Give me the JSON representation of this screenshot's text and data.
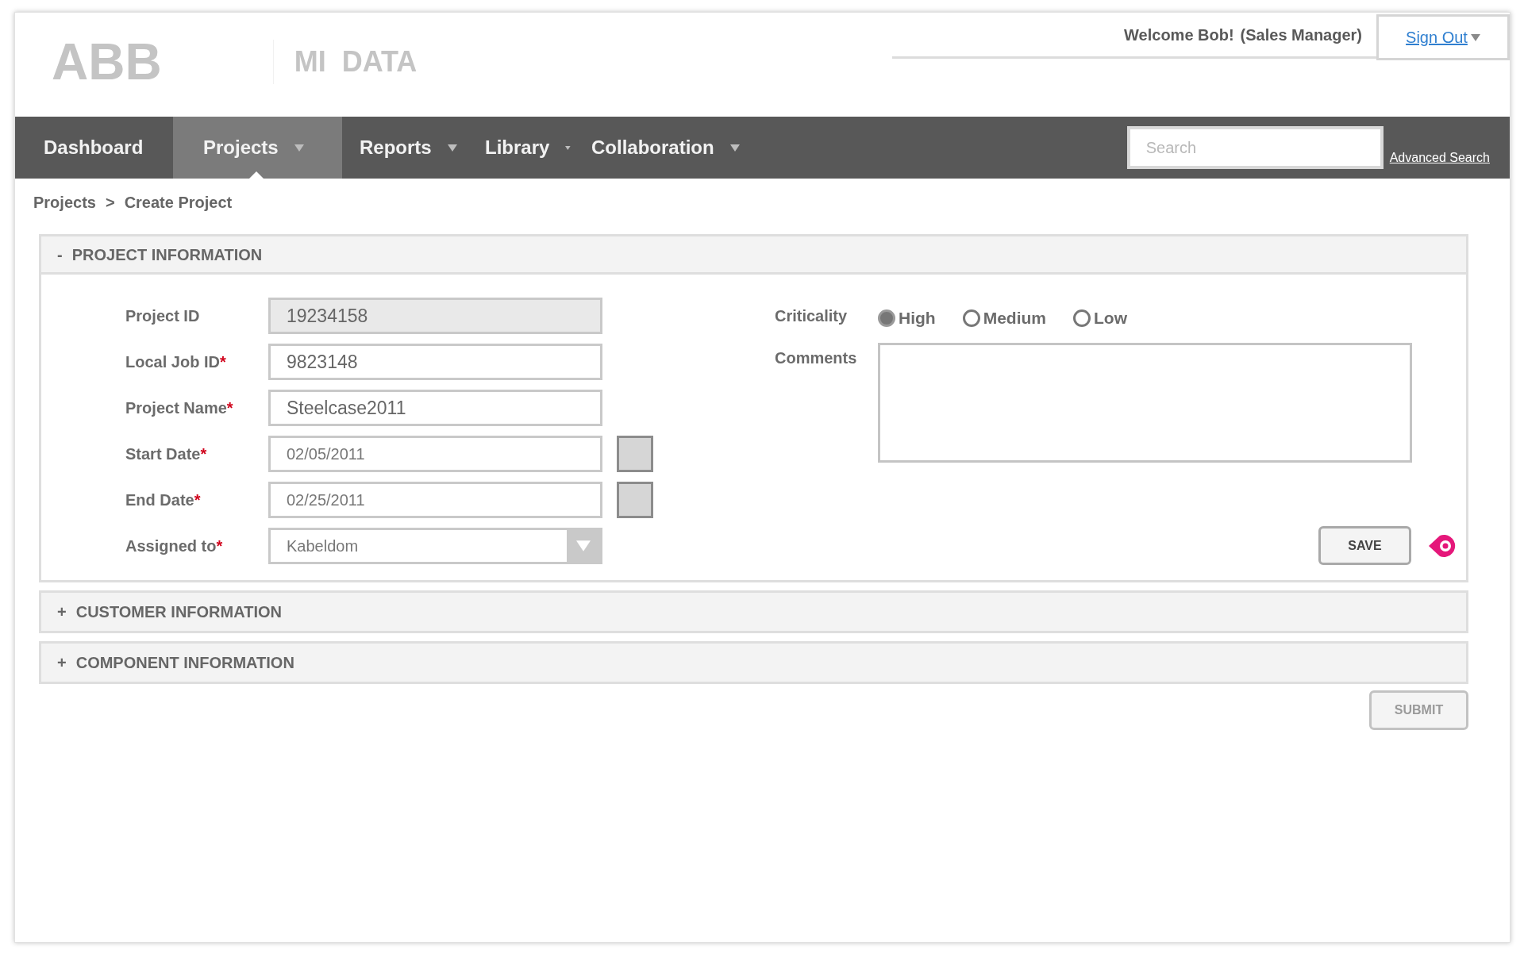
{
  "header": {
    "logo": "ABB",
    "app_name": "MI  DATA",
    "welcome": "Welcome Bob!",
    "role": "(Sales Manager)",
    "sign_out": "Sign Out"
  },
  "nav": {
    "items": [
      {
        "label": "Dashboard",
        "dropdown": false,
        "selected": false
      },
      {
        "label": "Projects",
        "dropdown": true,
        "selected": true
      },
      {
        "label": "Reports",
        "dropdown": true,
        "selected": false
      },
      {
        "label": "Library",
        "dropdown": true,
        "selected": false
      },
      {
        "label": "Collaboration",
        "dropdown": true,
        "selected": false
      }
    ],
    "search": {
      "placeholder": "Search"
    },
    "advanced_search": "Advanced Search"
  },
  "breadcrumb": {
    "items": [
      "Projects",
      "Create Project"
    ],
    "separator": ">"
  },
  "sections": [
    {
      "toggle": "-",
      "title": "PROJECT INFORMATION",
      "expanded": true
    },
    {
      "toggle": "+",
      "title": "CUSTOMER INFORMATION",
      "expanded": false
    },
    {
      "toggle": "+",
      "title": "COMPONENT INFORMATION",
      "expanded": false
    }
  ],
  "form": {
    "fields": [
      {
        "kind": "text",
        "label": "Project ID",
        "value": "19234158",
        "readonly": true
      },
      {
        "kind": "text",
        "label": "Local Job ID",
        "asterisk": "*",
        "value": "9823148",
        "readonly": false
      },
      {
        "kind": "text",
        "label": "Project Name",
        "asterisk": "*",
        "value": "Steelcase2011",
        "readonly": false
      },
      {
        "kind": "date",
        "label": "Start Date",
        "asterisk": "*",
        "value": "02/05/2011",
        "readonly": false
      },
      {
        "kind": "date",
        "label": "End Date",
        "asterisk": "*",
        "value": "02/25/2011",
        "readonly": false
      },
      {
        "kind": "select",
        "label": "Assigned to",
        "asterisk": "*",
        "value": "Kabeldom",
        "readonly": false
      }
    ],
    "criticality": {
      "label": "Criticality",
      "options": [
        {
          "label": "High",
          "selected": true
        },
        {
          "label": "Medium",
          "selected": false
        },
        {
          "label": "Low",
          "selected": false
        }
      ]
    },
    "comments": {
      "label": "Comments"
    },
    "save": "SAVE"
  },
  "submit": {
    "label": "SUBMIT",
    "disabled": true
  }
}
